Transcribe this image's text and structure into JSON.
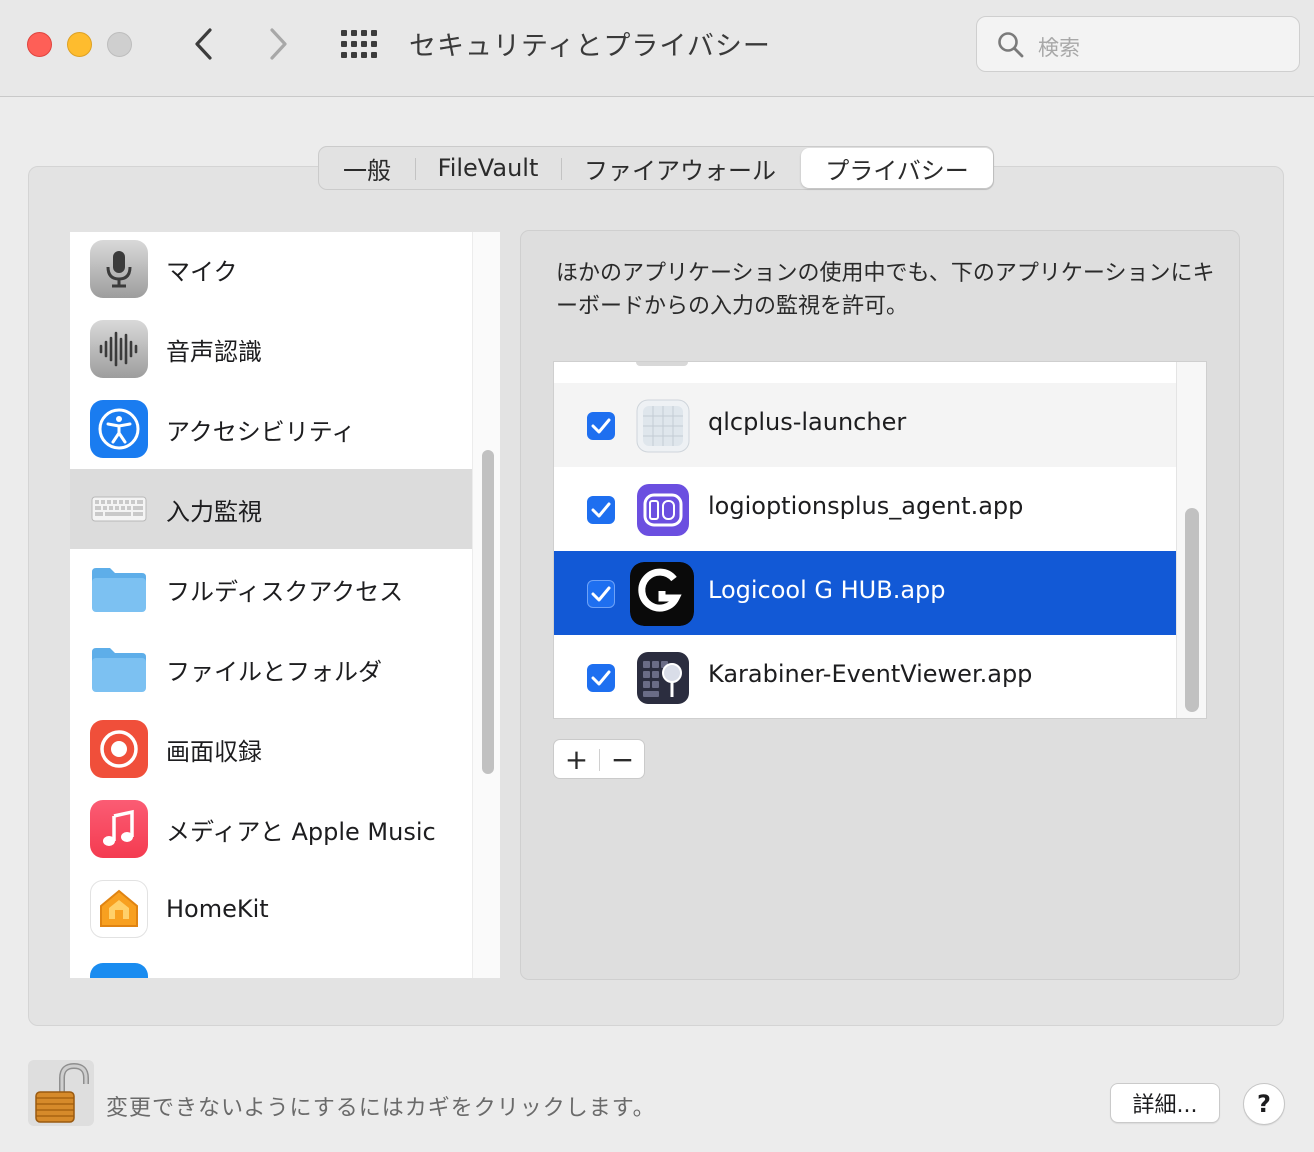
{
  "window": {
    "title": "セキュリティとプライバシー",
    "search_placeholder": "検索"
  },
  "tabs": [
    {
      "label": "一般"
    },
    {
      "label": "FileVault"
    },
    {
      "label": "ファイアウォール"
    },
    {
      "label": "プライバシー",
      "selected": true
    }
  ],
  "categories": [
    {
      "label": "マイク",
      "icon": "microphone-icon"
    },
    {
      "label": "音声認識",
      "icon": "waveform-icon"
    },
    {
      "label": "アクセシビリティ",
      "icon": "accessibility-icon"
    },
    {
      "label": "入力監視",
      "icon": "keyboard-icon",
      "selected": true
    },
    {
      "label": "フルディスクアクセス",
      "icon": "folder-icon"
    },
    {
      "label": "ファイルとフォルダ",
      "icon": "folder-icon"
    },
    {
      "label": "画面収録",
      "icon": "screen-record-icon"
    },
    {
      "label": "メディアと Apple Music",
      "icon": "music-note-icon"
    },
    {
      "label": "HomeKit",
      "icon": "homekit-icon"
    }
  ],
  "description": "ほかのアプリケーションの使用中でも、下のアプリケーションにキーボードからの入力の監視を許可。",
  "apps": [
    {
      "name": "qlcplus-launcher",
      "checked": true,
      "icon": "qlcplus-icon"
    },
    {
      "name": "logioptionsplus_agent.app",
      "checked": true,
      "icon": "logi-options-icon"
    },
    {
      "name": "Logicool G HUB.app",
      "checked": true,
      "icon": "logicool-g-icon",
      "selected": true
    },
    {
      "name": "Karabiner-EventViewer.app",
      "checked": true,
      "icon": "karabiner-icon"
    }
  ],
  "buttons": {
    "add": "+",
    "remove": "−",
    "advanced": "詳細...",
    "help": "?"
  },
  "footer": {
    "lock_text": "変更できないようにするにはカギをクリックします。"
  },
  "colors": {
    "selection": "#1259d6",
    "checkbox": "#1e6ff0"
  }
}
